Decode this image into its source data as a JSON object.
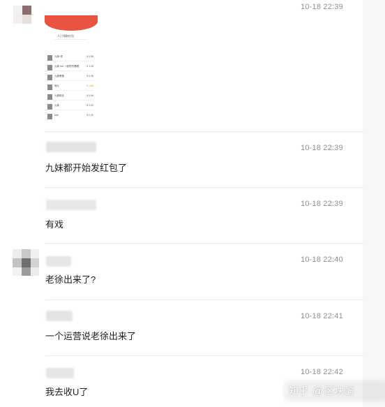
{
  "messages": [
    {
      "timestamp": "10-18 22:39",
      "text": ""
    },
    {
      "timestamp": "10-18 22:39",
      "text": "九妹都开始发红包了"
    },
    {
      "timestamp": "10-18 22:39",
      "text": "有戏"
    },
    {
      "timestamp": "10-18 22:40",
      "text": "老徐出来了?"
    },
    {
      "timestamp": "10-18 22:41",
      "text": "一个运营说老徐出来了"
    },
    {
      "timestamp": "10-18 22:42",
      "text": "我去收U了"
    }
  ],
  "thumbnail": {
    "title": "人已领取红包",
    "rows": [
      {
        "name": "九妹·领",
        "amount": "¥ 0.88"
      },
      {
        "name": "九妹 Kol 一起吃吃喝喝",
        "amount": "¥ 1.08"
      },
      {
        "name": "九妹爸爸",
        "amount": "¥ 0.98"
      },
      {
        "name": "阿九",
        "amount": "¥ 1.88"
      },
      {
        "name": "九妹粉丝",
        "amount": "¥ 0.66"
      },
      {
        "name": "九妹",
        "amount": "¥ 0.52"
      },
      {
        "name": "kofi",
        "amount": "¥ 0.30"
      }
    ]
  },
  "watermark": {
    "brand": "知乎",
    "at": "@",
    "author": "区块骗"
  },
  "colors": {
    "red_envelope": "#e9533f",
    "timestamp": "#8f8f8f",
    "divider": "#ececec"
  }
}
